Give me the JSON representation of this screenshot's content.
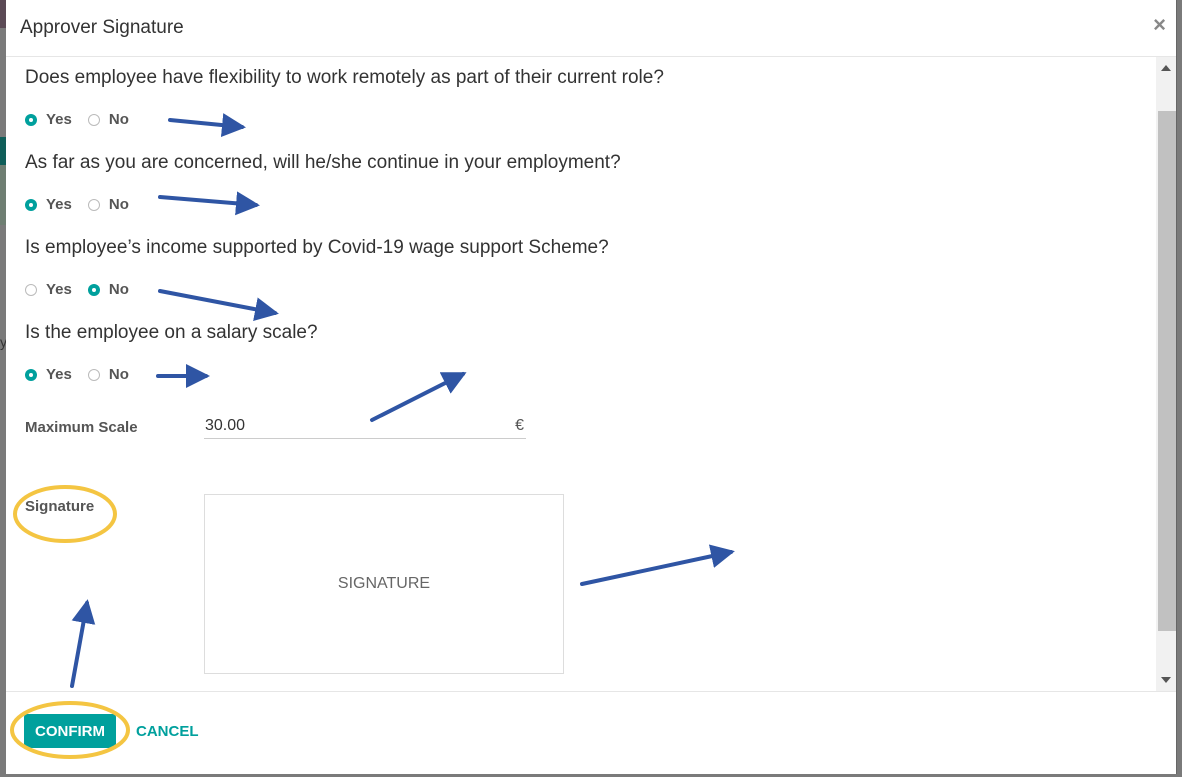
{
  "dialog": {
    "title": "Approver Signature",
    "close_label": "×"
  },
  "questions": [
    {
      "text": "Does employee have flexibility to work remotely as part of their current role?",
      "options": [
        "Yes",
        "No"
      ],
      "selected": "Yes"
    },
    {
      "text": "As far as you are concerned, will he/she continue in your employment?",
      "options": [
        "Yes",
        "No"
      ],
      "selected": "Yes"
    },
    {
      "text": "Is employee’s income supported by Covid-19 wage support Scheme?",
      "options": [
        "Yes",
        "No"
      ],
      "selected": "No"
    },
    {
      "text": "Is the employee on a salary scale?",
      "options": [
        "Yes",
        "No"
      ],
      "selected": "Yes"
    }
  ],
  "maximum_scale": {
    "label": "Maximum Scale",
    "value": "30.00",
    "currency": "€"
  },
  "signature": {
    "label": "Signature",
    "placeholder": "SIGNATURE"
  },
  "footer": {
    "confirm_label": "CONFIRM",
    "cancel_label": "CANCEL"
  },
  "background": {
    "partial_text": "y"
  },
  "colors": {
    "accent": "#00a09d",
    "annotation_arrow": "#2f55a4",
    "annotation_highlight": "#f4c542"
  }
}
